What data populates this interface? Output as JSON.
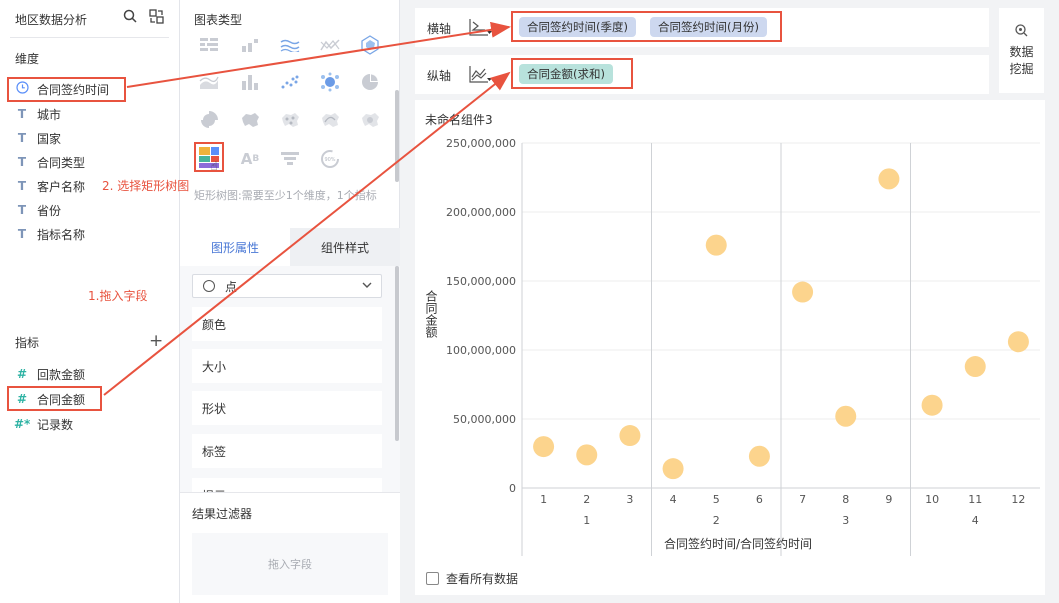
{
  "fields_panel": {
    "title": "地区数据分析",
    "dimension_heading": "维度",
    "dimensions": [
      {
        "label": "合同签约时间",
        "icon": "clock-icon"
      },
      {
        "label": "城市",
        "icon": "text-field-icon"
      },
      {
        "label": "国家",
        "icon": "text-field-icon"
      },
      {
        "label": "合同类型",
        "icon": "text-field-icon"
      },
      {
        "label": "客户名称",
        "icon": "text-field-icon"
      },
      {
        "label": "省份",
        "icon": "text-field-icon"
      },
      {
        "label": "指标名称",
        "icon": "text-field-icon"
      }
    ],
    "measure_heading": "指标",
    "add_symbol": "+",
    "measures": [
      {
        "label": "回款金额",
        "icon": "hash-icon"
      },
      {
        "label": "合同金额",
        "icon": "hash-icon"
      },
      {
        "label": "记录数",
        "icon": "hash-star-icon"
      }
    ]
  },
  "annotations": {
    "step1": "1.拖入字段",
    "step2": "2. 选择矩形树图",
    "highlight_color": "#e8533f"
  },
  "types_panel": {
    "title": "图表类型",
    "hint": "矩形树图:需要至少1个维度，1个指标",
    "tabs": [
      "图形属性",
      "组件样式"
    ],
    "mark_dropdown": "点",
    "properties": [
      "颜色",
      "大小",
      "形状",
      "标签",
      "提示"
    ],
    "filter_title": "结果过滤器",
    "filter_placeholder": "拖入字段",
    "gauge_text": "90%",
    "text_chart_glyph": "A",
    "text_chart_sup": "B"
  },
  "axes": {
    "x_label": "横轴",
    "y_label": "纵轴",
    "x_pills": [
      "合同签约时间(季度)",
      "合同签约时间(月份)"
    ],
    "y_pills": [
      "合同金额(求和)"
    ]
  },
  "mining": {
    "line1": "数据",
    "line2": "挖掘"
  },
  "component_title": "未命名组件3",
  "view_all_label": "查看所有数据",
  "colors": {
    "accent": "#4a78d6",
    "point": "#fcd48d",
    "dimension_pill": "#cdd8ef",
    "measure_pill": "#b8e2dc"
  },
  "chart_data": {
    "type": "scatter",
    "ylabel": "合同金额",
    "xlabel": "合同签约时间/合同签约时间",
    "ylim": [
      0,
      250000000
    ],
    "yticks": [
      "250,000,000",
      "200,000,000",
      "150,000,000",
      "100,000,000",
      "50,000,000",
      "0"
    ],
    "groups": [
      "1",
      "2",
      "3",
      "4"
    ],
    "categories": [
      "1",
      "2",
      "3",
      "4",
      "5",
      "6",
      "7",
      "8",
      "9",
      "10",
      "11",
      "12"
    ],
    "values": [
      30000000,
      24000000,
      38000000,
      14000000,
      176000000,
      23000000,
      142000000,
      52000000,
      224000000,
      60000000,
      88000000,
      106000000
    ]
  }
}
